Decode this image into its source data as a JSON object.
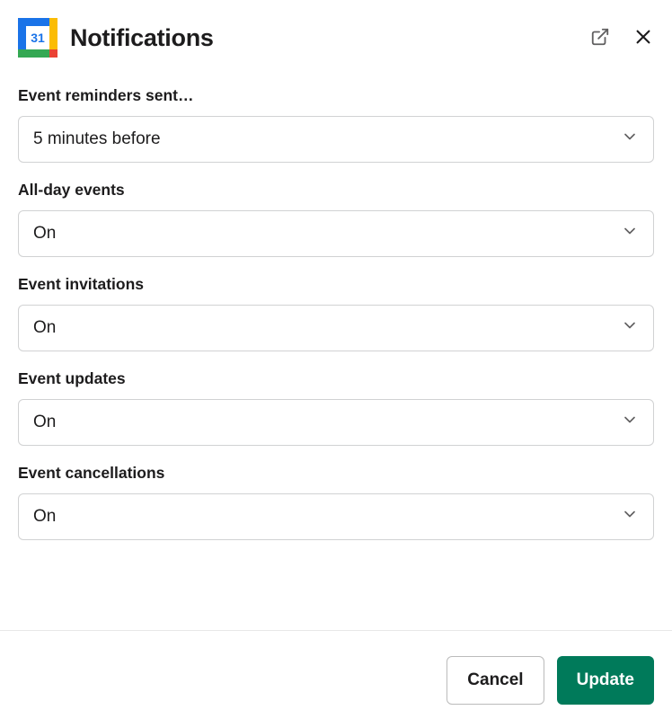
{
  "header": {
    "title": "Notifications",
    "app_icon": {
      "name": "google-calendar",
      "day_number": "31"
    }
  },
  "fields": {
    "event_reminders": {
      "label": "Event reminders sent…",
      "value": "5 minutes before"
    },
    "all_day_events": {
      "label": "All-day events",
      "value": "On"
    },
    "event_invitations": {
      "label": "Event invitations",
      "value": "On"
    },
    "event_updates": {
      "label": "Event updates",
      "value": "On"
    },
    "event_cancellations": {
      "label": "Event cancellations",
      "value": "On"
    }
  },
  "footer": {
    "cancel_label": "Cancel",
    "update_label": "Update"
  }
}
